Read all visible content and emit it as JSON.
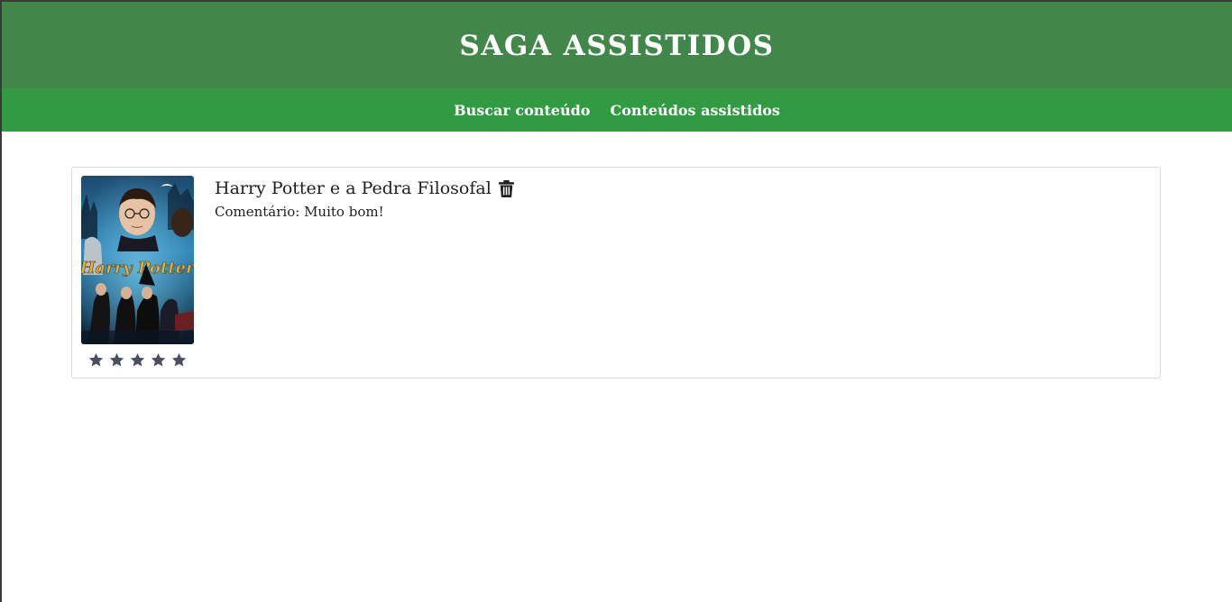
{
  "header": {
    "title": "SAGA ASSISTIDOS"
  },
  "nav": {
    "items": [
      {
        "label": "Buscar conteúdo"
      },
      {
        "label": "Conteúdos assistidos"
      }
    ]
  },
  "watched": {
    "items": [
      {
        "title": "Harry Potter e a Pedra Filosofal",
        "comment_label": "Comentário:",
        "comment": "Muito bom!",
        "rating": 5,
        "rating_max": 5,
        "poster_text": "Harry Potter"
      }
    ]
  },
  "colors": {
    "header_bg": "#41874a",
    "nav_bg": "#329a43",
    "star": "#4a4f5c"
  }
}
